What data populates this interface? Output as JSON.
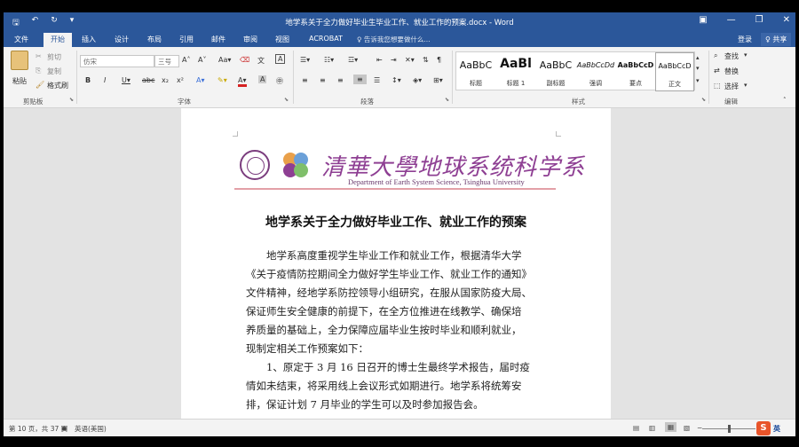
{
  "window": {
    "title": "地学系关于全力做好毕业生毕业工作、就业工作的预案.docx - Word"
  },
  "tabs": {
    "file": "文件",
    "home": "开始",
    "insert": "插入",
    "design": "设计",
    "layout": "布局",
    "references": "引用",
    "mailings": "邮件",
    "review": "审阅",
    "view": "视图",
    "acrobat": "ACROBAT",
    "tell_me": "♀ 告诉我您想要做什么...",
    "sign_in": "登录",
    "share": "♀ 共享"
  },
  "clipboard": {
    "paste": "粘贴",
    "cut": "剪切",
    "copy": "复制",
    "format_painter": "格式刷",
    "group": "剪贴板"
  },
  "font": {
    "name": "仿宋",
    "size": "三号",
    "group": "字体"
  },
  "paragraph": {
    "group": "段落"
  },
  "styles": {
    "group": "样式",
    "items": [
      {
        "sample": "AaBbC",
        "name": "标题"
      },
      {
        "sample": "AaBl",
        "name": "标题 1"
      },
      {
        "sample": "AaBbC",
        "name": "副标题"
      },
      {
        "sample": "AaBbCcDd",
        "name": "强调"
      },
      {
        "sample": "AaBbCcD",
        "name": "要点"
      },
      {
        "sample": "AaBbCcD",
        "name": "正文"
      }
    ]
  },
  "editing": {
    "find": "查找",
    "replace": "替换",
    "select": "选择",
    "group": "编辑"
  },
  "document": {
    "logo_text": "清華大學地球系统科学系",
    "logo_sub": "Department of Earth System Science, Tsinghua University",
    "title": "地学系关于全力做好毕业工作、就业工作的预案",
    "para1": [
      "地学系高度重视学生毕业工作和就业工作，根据清华大学",
      "《关于疫情防控期间全力做好学生毕业工作、就业工作的通知》",
      "文件精神，经地学系防控领导小组研究，在服从国家防疫大局、",
      "保证师生安全健康的前提下，在全方位推进在线教学、确保培",
      "养质量的基础上，全力保障应届毕业生按时毕业和顺利就业，",
      "现制定相关工作预案如下："
    ],
    "para2": [
      "1、原定于 3 月 16 日召开的博士生最终学术报告，届时疫",
      "情如未结束，将采用线上会议形式如期进行。地学系将统筹安",
      "排，保证计划 7 月毕业的学生可以及时参加报告会。"
    ]
  },
  "status": {
    "page": "第 10 页，共 37 页",
    "language": "英语(美国)",
    "ime_label": "英"
  },
  "colors": {
    "ribbon_blue": "#2b579a",
    "logo_purple": "#8e3f93"
  }
}
